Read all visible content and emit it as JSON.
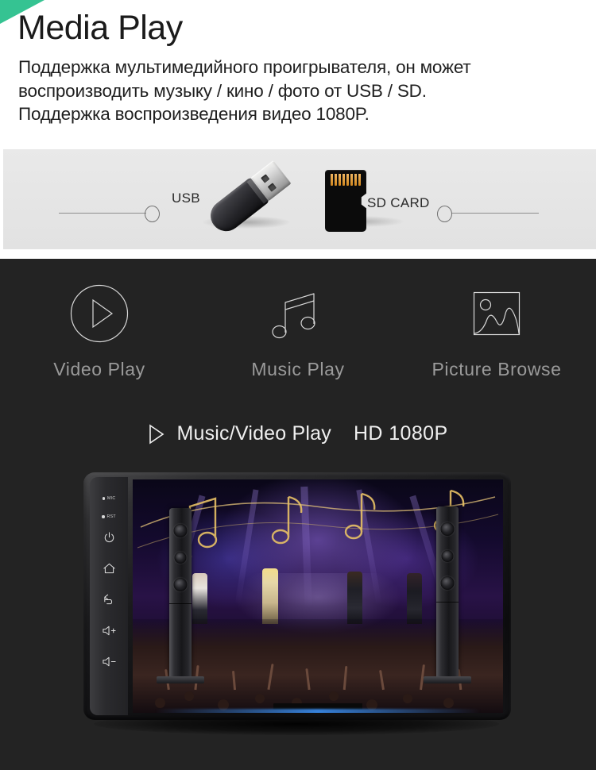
{
  "header": {
    "title": "Media Play",
    "lines": [
      "Поддержка мультимедийного проигрывателя, он может",
      "воспроизводить музыку / кино / фото от USB / SD.",
      "Поддержка воспроизведения видео 1080P."
    ],
    "corner_color": "#35c392"
  },
  "media_band": {
    "background_color": "#e6e6e6",
    "usb_label": "USB",
    "sd_label": "SD CARD",
    "usb_icon": "usb-flash-drive-icon",
    "sd_icon": "microsd-card-icon",
    "sd_pin_count": 8
  },
  "dark_section": {
    "background_color": "#232323",
    "features": [
      {
        "icon": "play-circle-icon",
        "label": "Video Play"
      },
      {
        "icon": "music-note-icon",
        "label": "Music Play"
      },
      {
        "icon": "picture-frame-icon",
        "label": "Picture Browse"
      }
    ],
    "headline": {
      "icon": "play-triangle-icon",
      "text": "Music/Video Play",
      "resolution": "HD 1080P"
    }
  },
  "head_unit": {
    "device": "car-head-unit",
    "side_buttons": [
      {
        "type": "dot-label",
        "name": "mic-indicator",
        "label": "MIC"
      },
      {
        "type": "dot-label",
        "name": "reset-indicator",
        "label": "RST"
      },
      {
        "type": "icon",
        "name": "power-button",
        "glyph": "power"
      },
      {
        "type": "icon",
        "name": "home-button",
        "glyph": "home"
      },
      {
        "type": "icon",
        "name": "back-button",
        "glyph": "back"
      },
      {
        "type": "icon",
        "name": "volume-up-button",
        "glyph": "volume-plus"
      },
      {
        "type": "icon",
        "name": "volume-down-button",
        "glyph": "volume-minus"
      }
    ],
    "screen_content": "concert-stage-with-band-and-crowd",
    "speakers": 2
  }
}
